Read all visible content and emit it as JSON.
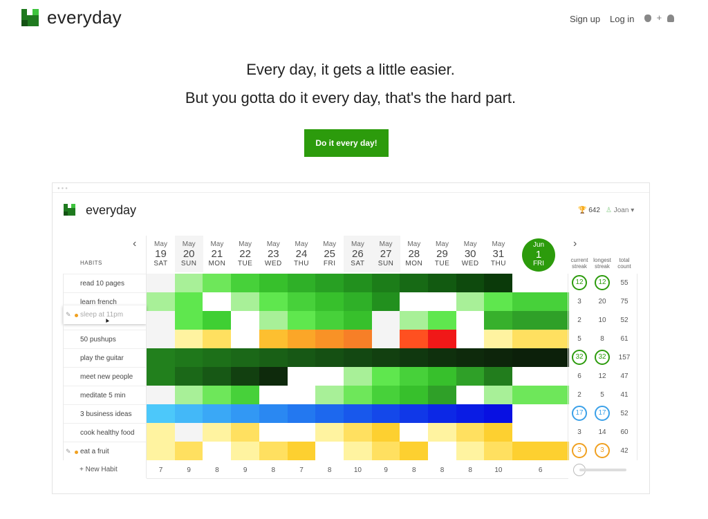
{
  "header": {
    "brand": "everyday",
    "signup": "Sign up",
    "login": "Log in",
    "apple_icon": "",
    "plus": "+",
    "android_icon": "android-icon"
  },
  "hero": {
    "line1": "Every day, it gets a little easier.",
    "line2": "But you gotta do it every day, that's the hard part.",
    "cta": "Do it every day!"
  },
  "app": {
    "brand": "everyday",
    "points": "642",
    "user": "Joan ▾",
    "habits_header": "HABITS",
    "stat_headers": [
      "current\nstreak",
      "longest\nstreak",
      "total\ncount"
    ],
    "dates": [
      {
        "m": "May",
        "d": "19",
        "w": "SAT"
      },
      {
        "m": "May",
        "d": "20",
        "w": "SUN"
      },
      {
        "m": "May",
        "d": "21",
        "w": "MON"
      },
      {
        "m": "May",
        "d": "22",
        "w": "TUE"
      },
      {
        "m": "May",
        "d": "23",
        "w": "WED"
      },
      {
        "m": "May",
        "d": "24",
        "w": "THU"
      },
      {
        "m": "May",
        "d": "25",
        "w": "FRI"
      },
      {
        "m": "May",
        "d": "26",
        "w": "SAT"
      },
      {
        "m": "May",
        "d": "27",
        "w": "SUN"
      },
      {
        "m": "May",
        "d": "28",
        "w": "MON"
      },
      {
        "m": "May",
        "d": "29",
        "w": "TUE"
      },
      {
        "m": "May",
        "d": "30",
        "w": "WED"
      },
      {
        "m": "May",
        "d": "31",
        "w": "THU"
      }
    ],
    "today": {
      "m": "Jun",
      "d": "1",
      "w": "FRI"
    },
    "habits": [
      {
        "name": "read 10 pages",
        "current": "12",
        "longest": "12",
        "total": "55",
        "ring": "#2c9b0c",
        "cells": [
          "#f4f4f4",
          "#a8f098",
          "#6ee75a",
          "#47d13a",
          "#37c02c",
          "#2fb028",
          "#28a023",
          "#22901e",
          "#1c7d19",
          "#176a15",
          "#125a11",
          "#0e4a0d",
          "#0b3a0a",
          ""
        ]
      },
      {
        "name": "learn french",
        "current": "3",
        "longest": "20",
        "total": "75",
        "ring": "",
        "cells": [
          "#a8f098",
          "#5fe74e",
          "#ffffff",
          "#a8f098",
          "#5fe74e",
          "#47d13a",
          "#37c02c",
          "#2fb028",
          "#22901e",
          "#ffffff",
          "#ffffff",
          "#a8f098",
          "#5fe74e",
          "#47d13a"
        ]
      },
      {
        "name": "sleep at 11pm",
        "current": "2",
        "longest": "10",
        "total": "52",
        "ring": "",
        "cells": [
          "#f4f4f4",
          "#5fe74e",
          "#3fcf33",
          "#ffffff",
          "#a8f098",
          "#5fe74e",
          "#47d13a",
          "#37c02c",
          "#f4f4f4",
          "#a8f098",
          "#5fe74e",
          "#ffffff",
          "#37b02c",
          "#2fa028"
        ]
      },
      {
        "name": "50 pushups",
        "current": "5",
        "longest": "8",
        "total": "61",
        "ring": "",
        "cells": [
          "#f4f4f4",
          "#fff3a0",
          "#ffe060",
          "#ffffff",
          "#fdbf30",
          "#fba628",
          "#f99226",
          "#f77f27",
          "#f4f4f4",
          "#ff5020",
          "#f01818",
          "#ffffff",
          "#fff3a0",
          "#ffe060"
        ]
      },
      {
        "name": "play the guitar",
        "current": "32",
        "longest": "32",
        "total": "157",
        "ring": "#2c9b0c",
        "cells": [
          "#22801d",
          "#1f781b",
          "#1d7019",
          "#1b6818",
          "#196016",
          "#175815",
          "#155013",
          "#134812",
          "#124010",
          "#10380f",
          "#0f300d",
          "#0e2a0c",
          "#0d250b",
          "#0c200a"
        ]
      },
      {
        "name": "meet new people",
        "current": "6",
        "longest": "12",
        "total": "47",
        "ring": "",
        "cells": [
          "#22801d",
          "#1b6818",
          "#175815",
          "#124010",
          "#0e2a0c",
          "#ffffff",
          "#ffffff",
          "#a8f098",
          "#5fe74e",
          "#47d13a",
          "#37c02c",
          "#2fa028",
          "#227d1d",
          ""
        ]
      },
      {
        "name": "meditate 5 min",
        "current": "2",
        "longest": "5",
        "total": "41",
        "ring": "",
        "cells": [
          "#f4f4f4",
          "#a8f098",
          "#6ee75a",
          "#47d13a",
          "#ffffff",
          "#ffffff",
          "#a8f098",
          "#6ee75a",
          "#47d13a",
          "#37c02c",
          "#2fa028",
          "#ffffff",
          "#a8f098",
          "#6ee75a"
        ]
      },
      {
        "name": "3 business ideas",
        "current": "17",
        "longest": "17",
        "total": "52",
        "ring": "#3aa0e8",
        "cells": [
          "#4cc8fa",
          "#43b8f8",
          "#3aa8f6",
          "#3298f4",
          "#2a88f2",
          "#2378f0",
          "#1d68ee",
          "#1858ec",
          "#1448ea",
          "#1038e8",
          "#0c28e6",
          "#0a1ce4",
          "#0810e2",
          ""
        ]
      },
      {
        "name": "cook healthy food",
        "current": "3",
        "longest": "14",
        "total": "60",
        "ring": "",
        "cells": [
          "#fff3a0",
          "#f4f4f4",
          "#fff3a0",
          "#ffe060",
          "#ffffff",
          "#ffffff",
          "#fff3a0",
          "#ffe060",
          "#fdd030",
          "#ffffff",
          "#fff3a0",
          "#ffe060",
          "#fdd030",
          ""
        ]
      },
      {
        "name": "eat a fruit",
        "current": "3",
        "longest": "3",
        "total": "42",
        "ring": "#f0a020",
        "cells": [
          "#fff3a0",
          "#ffe060",
          "#ffffff",
          "#fff3a0",
          "#ffe060",
          "#fdd030",
          "#ffffff",
          "#fff3a0",
          "#ffe060",
          "#fdd030",
          "#ffffff",
          "#fff3a0",
          "#ffe060",
          "#fdd030"
        ]
      }
    ],
    "totals": [
      "7",
      "9",
      "8",
      "9",
      "8",
      "7",
      "8",
      "10",
      "9",
      "8",
      "8",
      "8",
      "10",
      "6"
    ],
    "new_habit": "+ New Habit"
  },
  "colors": {
    "brand_green": "#2c9b0c"
  }
}
